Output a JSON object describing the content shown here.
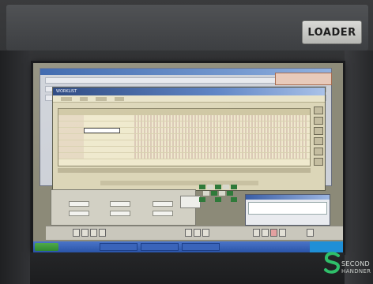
{
  "machine": {
    "panel_label": "LOADER"
  },
  "watermark": {
    "line1": "SECOND",
    "line2": "HANDNER"
  },
  "screen": {
    "main_window_title": "WORKLIST",
    "menu": [
      "",
      "",
      "",
      ""
    ],
    "table_headers": [
      "",
      "",
      "",
      ""
    ]
  },
  "colors": {
    "bezel": "#2c2d2f",
    "plate": "#c8c9c5",
    "titlebar": "#2f5da8",
    "window_body": "#dcd6b8",
    "taskbar": "#2a54a8",
    "watermark_green": "#2fbf6a"
  }
}
